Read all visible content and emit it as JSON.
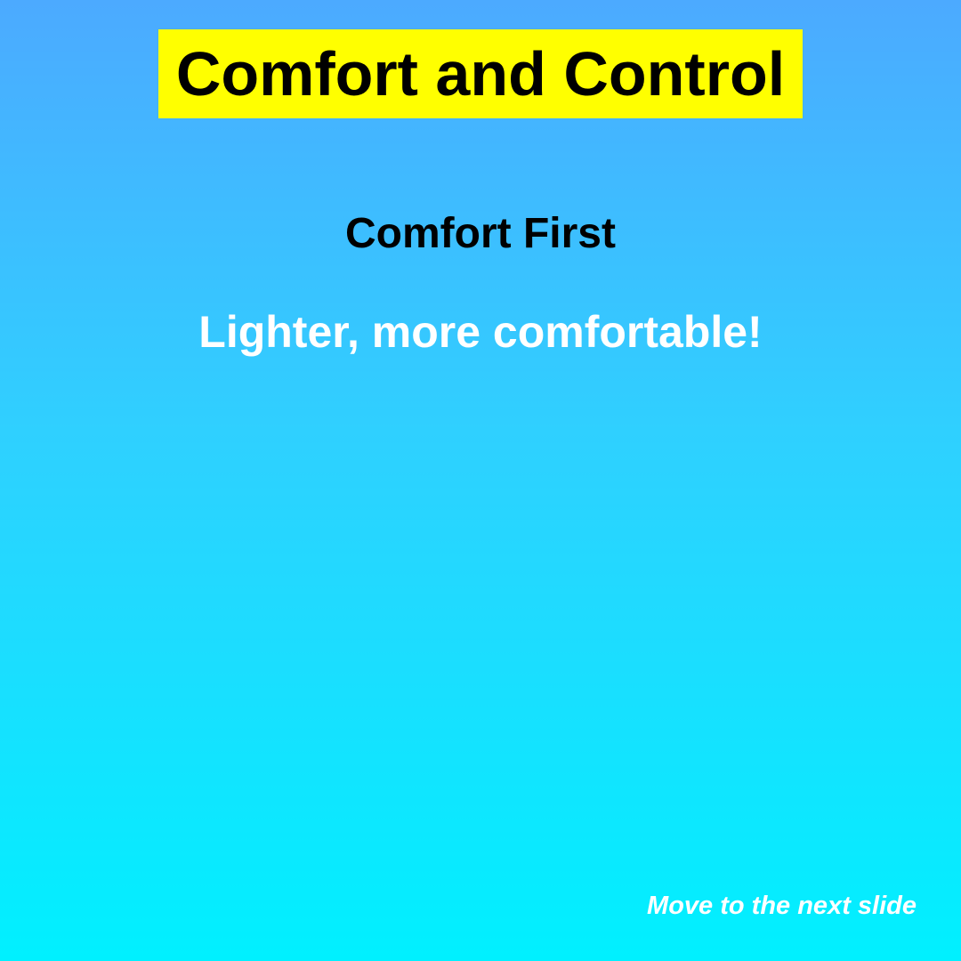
{
  "slide": {
    "title": "Comfort and Control",
    "subtitle": "Comfort First",
    "tagline": "Lighter, more comfortable!",
    "next_label": "Move to the next slide"
  },
  "colors": {
    "background_top": "#4caaff",
    "background_bottom": "#00f0ff",
    "title_highlight": "#ffff00",
    "title_text": "#000000",
    "subtitle_text": "#000000",
    "tagline_text": "#ffffff",
    "next_link_text": "#ffffff"
  }
}
